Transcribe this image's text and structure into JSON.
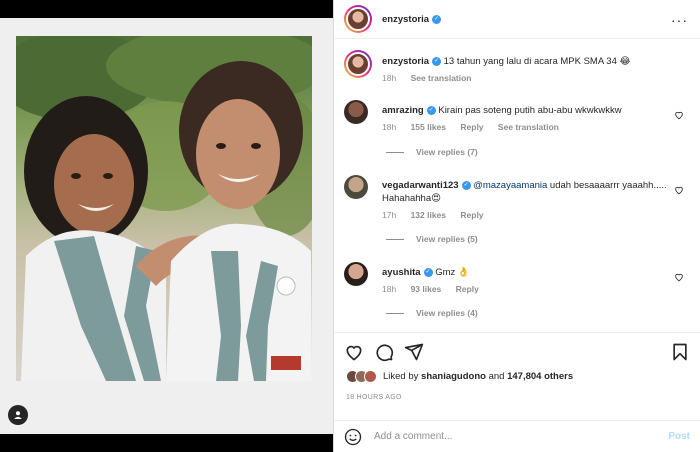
{
  "post": {
    "author": "enzystoria",
    "caption": "13 tahun yang lalu di acara MPK SMA 34 😂",
    "caption_time": "18h",
    "see_translation": "See translation"
  },
  "comments": [
    {
      "username": "amrazing",
      "text": "Kirain pas soteng putih abu-abu wkwkwkkw",
      "time": "18h",
      "likes": "155 likes",
      "reply": "Reply",
      "translation": "See translation",
      "view_replies": "View replies (7)"
    },
    {
      "username": "vegadarwanti123",
      "mention": "@mazayaamania",
      "text": " udah besaaaarrr yaaahh..... Hahahahha😍",
      "time": "17h",
      "likes": "132 likes",
      "reply": "Reply",
      "view_replies": "View replies (5)"
    },
    {
      "username": "ayushita",
      "text": "Gmz 👌",
      "time": "18h",
      "likes": "93 likes",
      "reply": "Reply",
      "view_replies": "View replies (4)"
    }
  ],
  "likes": {
    "prefix": "Liked by",
    "user": "shaniagudono",
    "joiner": "and",
    "count": "147,804 others"
  },
  "timestamp": "18 HOURS AGO",
  "composer": {
    "placeholder": "Add a comment...",
    "post_label": "Post"
  },
  "colors": {
    "verified": "#3897f0",
    "link_disabled": "#b2dffc",
    "muted": "#8e8e8e"
  }
}
